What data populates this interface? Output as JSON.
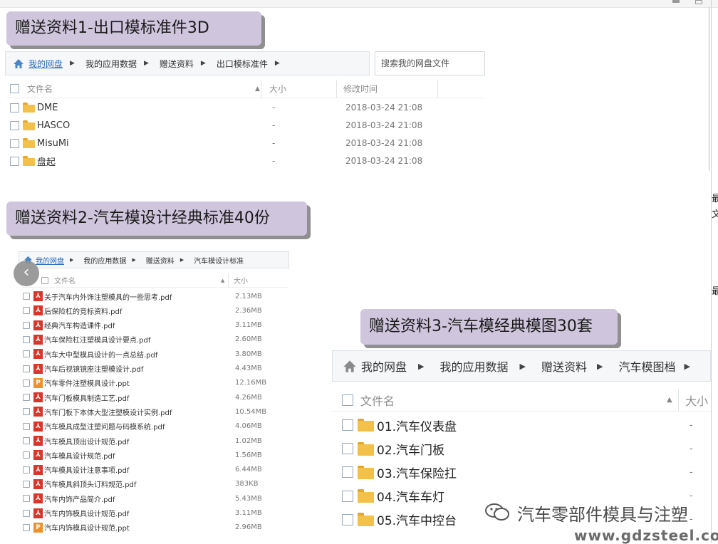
{
  "section1": {
    "banner": "赠送资料1-出口模标准件3D",
    "breadcrumb": [
      "我的网盘",
      "我的应用数据",
      "赠送资料",
      "出口模标准件"
    ],
    "search_placeholder": "搜索我的网盘文件",
    "columns": {
      "name": "文件名",
      "size": "大小",
      "modified": "修改时间"
    },
    "files": [
      {
        "name": "DME",
        "size": "-",
        "modified": "2018-03-24 21:08"
      },
      {
        "name": "HASCO",
        "size": "-",
        "modified": "2018-03-24 21:08"
      },
      {
        "name": "MisuMi",
        "size": "-",
        "modified": "2018-03-24 21:08"
      },
      {
        "name": "盘起",
        "size": "-",
        "modified": "2018-03-24 21:08"
      }
    ]
  },
  "section2": {
    "banner": "赠送资料2-汽车模设计经典标准40份",
    "breadcrumb": [
      "我的网盘",
      "我的应用数据",
      "赠送资料",
      "汽车模设计标准"
    ],
    "columns": {
      "name": "文件名",
      "size": "大小"
    },
    "files": [
      {
        "name": "关于汽车内外饰注塑模具的一些思考.pdf",
        "type": "pdf",
        "size": "2.13MB"
      },
      {
        "name": "后保险杠的竞标资料.pdf",
        "type": "pdf",
        "size": "2.36MB"
      },
      {
        "name": "经典汽车构造课件.pdf",
        "type": "pdf",
        "size": "3.11MB"
      },
      {
        "name": "汽车保险杠注塑模具设计要点.pdf",
        "type": "pdf",
        "size": "2.60MB"
      },
      {
        "name": "汽车大中型模具设计的一点总结.pdf",
        "type": "pdf",
        "size": "3.80MB"
      },
      {
        "name": "汽车后视镜镜座注塑模设计.pdf",
        "type": "pdf",
        "size": "4.43MB"
      },
      {
        "name": "汽车零件注塑模具设计.ppt",
        "type": "ppt",
        "size": "12.16MB"
      },
      {
        "name": "汽车门板模具制造工艺.pdf",
        "type": "pdf",
        "size": "4.26MB"
      },
      {
        "name": "汽车门板下本体大型注塑模设计实例.pdf",
        "type": "pdf",
        "size": "10.54MB"
      },
      {
        "name": "汽车模具成型注塑问题与码模系统.pdf",
        "type": "pdf",
        "size": "4.06MB"
      },
      {
        "name": "汽车模具顶出设计规范.pdf",
        "type": "pdf",
        "size": "1.02MB"
      },
      {
        "name": "汽车模具设计规范.pdf",
        "type": "pdf",
        "size": "1.56MB"
      },
      {
        "name": "汽车模具设计注意事项.pdf",
        "type": "pdf",
        "size": "6.44MB"
      },
      {
        "name": "汽车模具斜顶头订料规范.pdf",
        "type": "pdf",
        "size": "383KB"
      },
      {
        "name": "汽车内饰产品简介.pdf",
        "type": "pdf",
        "size": "5.43MB"
      },
      {
        "name": "汽车内饰模具设计规范.pdf",
        "type": "pdf",
        "size": "3.11MB"
      },
      {
        "name": "汽车内饰模具设计规范.ppt",
        "type": "ppt",
        "size": "2.96MB"
      }
    ]
  },
  "section3": {
    "banner": "赠送资料3-汽车模经典模图30套",
    "breadcrumb": [
      "我的网盘",
      "我的应用数据",
      "赠送资料",
      "汽车模图档"
    ],
    "columns": {
      "name": "文件名",
      "size": "大小"
    },
    "files": [
      {
        "name": "01.汽车仪表盘",
        "size": "-"
      },
      {
        "name": "02.汽车门板",
        "size": "-"
      },
      {
        "name": "03.汽车保险扛",
        "size": "-"
      },
      {
        "name": "04.汽车车灯",
        "size": "-"
      },
      {
        "name": "05.汽车中控台",
        "size": "-"
      }
    ]
  },
  "watermark": {
    "wechat": "汽车零部件模具与注塑",
    "url": "www.gdzsteel.com"
  },
  "nav": {
    "prev_arrow": "‹"
  },
  "right_edge": {
    "chars": [
      "最",
      "文",
      "最"
    ]
  },
  "colors": {
    "banner_bg": "#cfc6dd",
    "link": "#2d6cc0",
    "folder": "#f3c04a",
    "pdf": "#d9352b",
    "ppt": "#f0902a"
  }
}
